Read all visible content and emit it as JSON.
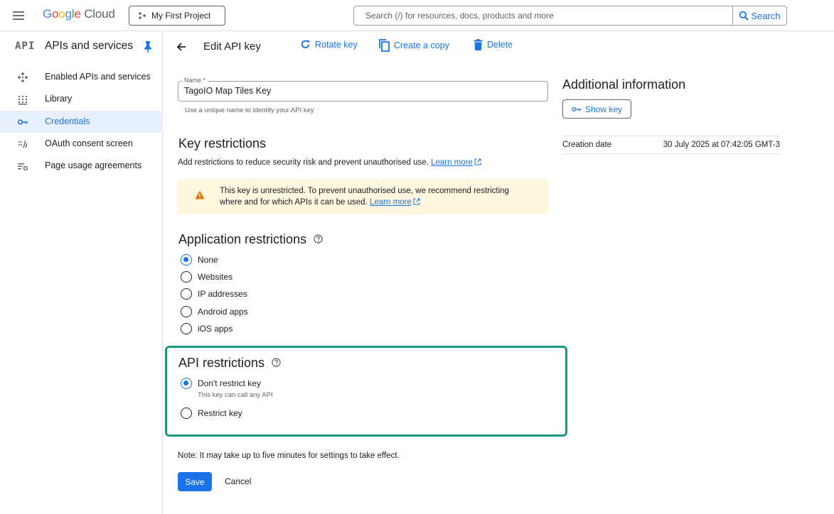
{
  "topbar": {
    "logo_google": [
      "G",
      "o",
      "o",
      "g",
      "l",
      "e"
    ],
    "logo_cloud": "Cloud",
    "project": "My First Project",
    "search_placeholder": "Search (/) for resources, docs, products and more",
    "search_button": "Search"
  },
  "sidebar": {
    "badge": "API",
    "title": "APIs and services",
    "items": [
      {
        "label": "Enabled APIs and services",
        "icon": "api-hub-icon"
      },
      {
        "label": "Library",
        "icon": "library-icon"
      },
      {
        "label": "Credentials",
        "icon": "key-icon",
        "active": true
      },
      {
        "label": "OAuth consent screen",
        "icon": "oauth-icon"
      },
      {
        "label": "Page usage agreements",
        "icon": "settings-list-icon"
      }
    ]
  },
  "header": {
    "title": "Edit API key",
    "rotate": "Rotate key",
    "copy": "Create a copy",
    "delete": "Delete"
  },
  "form": {
    "name_label": "Name *",
    "name_value": "TagoIO Map Tiles Key",
    "name_helper": "Use a unique name to identify your API key",
    "key_restrictions_title": "Key restrictions",
    "key_restrictions_desc": "Add restrictions to reduce security risk and prevent unauthorised use.",
    "learn_more": "Learn more",
    "warning_line1": "This key is unrestricted. To prevent unauthorised use, we recommend restricting",
    "warning_line2": "where and for which APIs it can be used.",
    "app_restrictions_title": "Application restrictions",
    "app_options": [
      "None",
      "Websites",
      "IP addresses",
      "Android apps",
      "iOS apps"
    ],
    "app_selected": "None",
    "api_restrictions_title": "API restrictions",
    "api_option_1": "Don't restrict key",
    "api_option_1_sub": "This key can call any API",
    "api_option_2": "Restrict key",
    "api_selected": "Don't restrict key",
    "note": "Note: It may take up to five minutes for settings to take effect.",
    "save": "Save",
    "cancel": "Cancel"
  },
  "info": {
    "title": "Additional information",
    "show_key": "Show key",
    "creation_label": "Creation date",
    "creation_value": "30 July 2025 at 07:42:05 GMT-3"
  },
  "colors": {
    "accent": "#1a73e8",
    "highlight": "#1a9a82",
    "warning_bg": "#fef7e0",
    "warning_icon": "#e37400",
    "delete_icon": "#1a73e8"
  }
}
